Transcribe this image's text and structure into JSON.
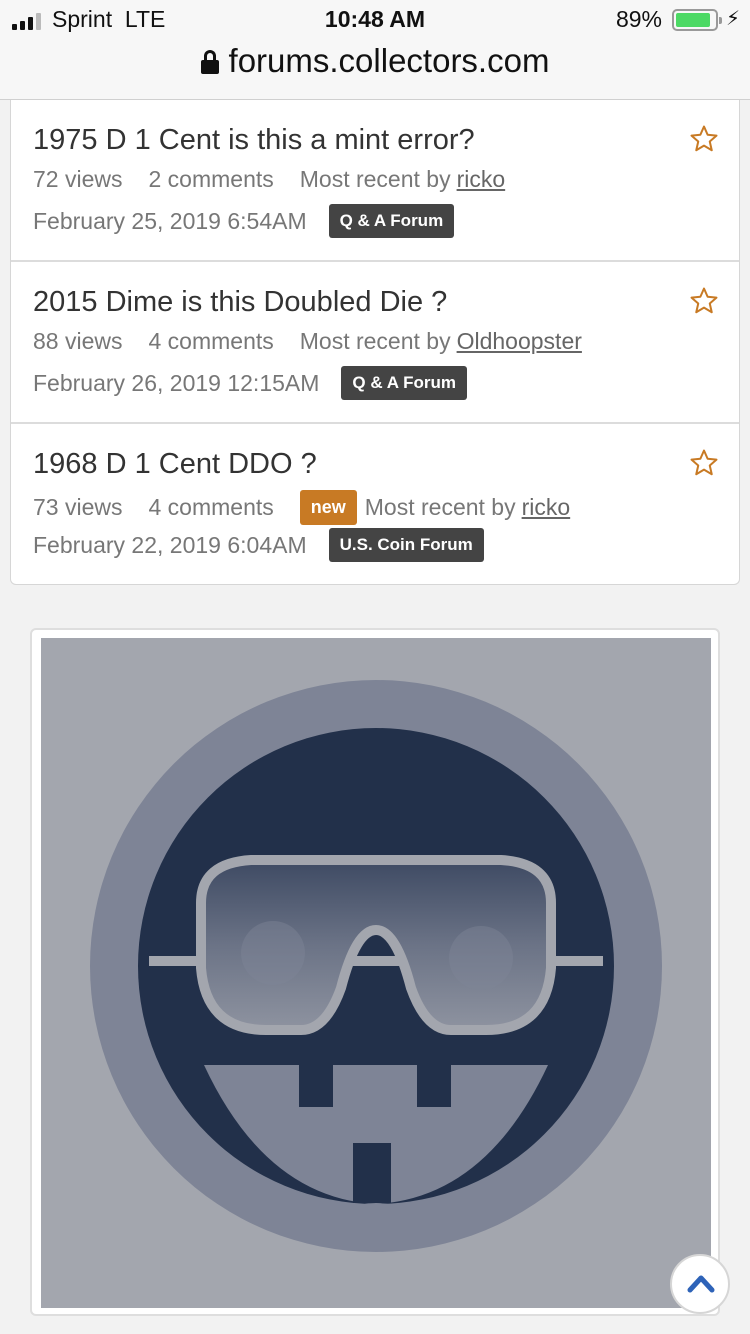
{
  "status_bar": {
    "carrier": "Sprint",
    "network": "LTE",
    "time": "10:48 AM",
    "battery_percent": "89%",
    "battery_level": 0.89,
    "charging_icon": "bolt-icon"
  },
  "url_bar": {
    "domain": "forums.collectors.com",
    "lock_icon": "lock-icon"
  },
  "discussions": [
    {
      "title": "1975 D 1 Cent is this a mint error?",
      "views": "72 views",
      "comments": "2 comments",
      "most_recent_label": "Most recent by",
      "author": "ricko",
      "new_badge": "",
      "date": "February 25, 2019 6:54AM",
      "category": "Q & A Forum"
    },
    {
      "title": "2015 Dime is this Doubled Die ?",
      "views": "88 views",
      "comments": "4 comments",
      "most_recent_label": "Most recent by",
      "author": "Oldhoopster",
      "new_badge": "",
      "date": "February 26, 2019 12:15AM",
      "category": "Q & A Forum"
    },
    {
      "title": "1968 D 1 Cent DDO ?",
      "views": "73 views",
      "comments": "4 comments",
      "most_recent_label": "Most recent by",
      "author": "ricko",
      "new_badge": "new",
      "date": "February 22, 2019 6:04AM",
      "category": "U.S. Coin Forum"
    }
  ],
  "colors": {
    "tag_bg": "#444444",
    "new_badge_bg": "#c87a24",
    "star_outline": "#c87a24",
    "avatar_bg": "#a3a6ae",
    "avatar_dark": "#22304a"
  },
  "icons": {
    "star": "star-outline-icon",
    "scroll_top": "chevron-up-icon",
    "avatar": "goggles-face-avatar"
  }
}
